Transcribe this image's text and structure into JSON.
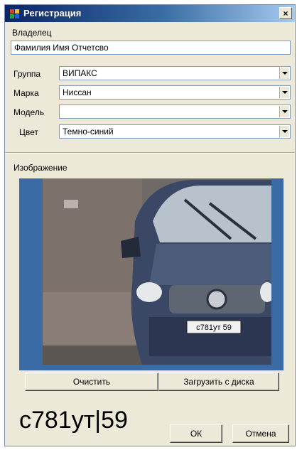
{
  "window": {
    "title": "Регистрация",
    "close_glyph": "×"
  },
  "fields": {
    "owner_label": "Владелец",
    "owner_value": "Фамилия Имя Отчетсво",
    "group_label": "Группа",
    "group_value": "ВИПАКС",
    "make_label": "Марка",
    "make_value": "Ниссан",
    "model_label": "Модель",
    "model_value": "",
    "color_label": "Цвет",
    "color_value": "Темно-синий"
  },
  "image_section": {
    "label": "Изображение",
    "photo_plate_text": "с781ут 59",
    "clear_button": "Очистить",
    "load_button": "Загрузить с диска"
  },
  "plate_number": "с781ут|59",
  "dialog_buttons": {
    "ok": "ОК",
    "cancel": "Отмена"
  },
  "colors": {
    "title_start": "#0a246a",
    "title_end": "#a6caf0",
    "image_bg": "#3b6ba4",
    "car_body": "#3a4866"
  },
  "icons": [
    "app-icon",
    "close-icon",
    "dropdown-arrow-icon"
  ]
}
